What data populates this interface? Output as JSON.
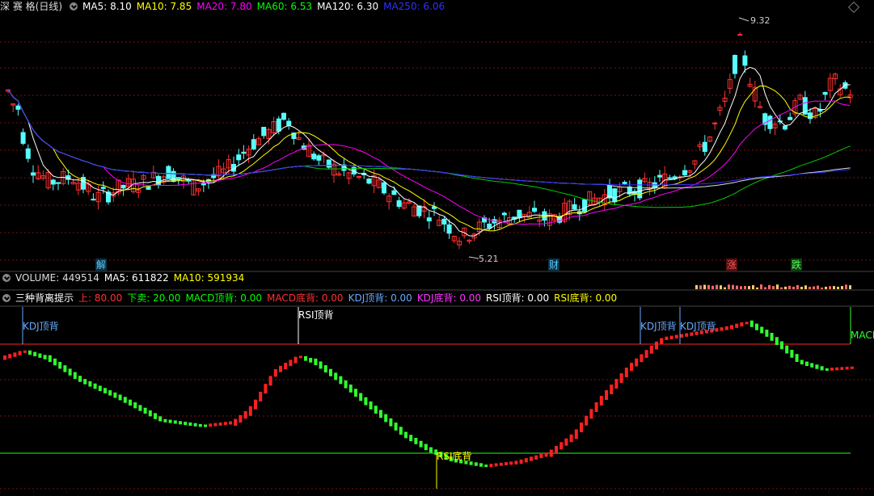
{
  "header": {
    "stock_name": "深 赛 格",
    "period": "(日线)",
    "ma": [
      {
        "label": "MA5: 8.10",
        "color": "#ffffff"
      },
      {
        "label": "MA10: 7.85",
        "color": "#ffff00"
      },
      {
        "label": "MA20: 7.80",
        "color": "#ff00ff"
      },
      {
        "label": "MA60: 6.53",
        "color": "#00ff00"
      },
      {
        "label": "MA120: 6.30",
        "color": "#ffffff"
      },
      {
        "label": "MA250: 6.06",
        "color": "#3030ff"
      }
    ]
  },
  "price_annotations": {
    "high": "9.32",
    "low": "5.21"
  },
  "event_markers": [
    {
      "text": "解",
      "color": "#55ccff"
    },
    {
      "text": "财",
      "color": "#55ccff"
    },
    {
      "text": "涨",
      "color": "#ff5555"
    },
    {
      "text": "跌",
      "color": "#55ff55"
    }
  ],
  "volume": {
    "label": "VOLUME: 449514",
    "ma5": "MA5: 611822",
    "ma10": "MA10: 591934"
  },
  "indicator": {
    "name": "三种背离提示",
    "fields": [
      {
        "label": "上: 80.00",
        "color": "#ff3030"
      },
      {
        "label": "下卖: 20.00",
        "color": "#00ff00"
      },
      {
        "label": "MACD顶背: 0.00",
        "color": "#00ff00"
      },
      {
        "label": "MACD底背: 0.00",
        "color": "#ff3030"
      },
      {
        "label": "KDJ顶背: 0.00",
        "color": "#66aaff"
      },
      {
        "label": "KDJ底背: 0.00",
        "color": "#ff33ff"
      },
      {
        "label": "RSI顶背: 0.00",
        "color": "#ffffff"
      },
      {
        "label": "RSI底背: 0.00",
        "color": "#ffff00"
      }
    ],
    "signals": {
      "kdj_top_1": "KDJ顶背",
      "rsi_top": "RSI顶背",
      "kdj_top_2": "KDJ顶背",
      "kdj_top_3": "KDJ顶背",
      "macd_edge": "MACD",
      "rsi_bottom": "RSI底背"
    },
    "levels": {
      "upper": 80,
      "lower": 20
    }
  },
  "colors": {
    "up": "#ff3030",
    "down": "#55ffff",
    "grid": "#7a1010",
    "background": "#000000"
  }
}
